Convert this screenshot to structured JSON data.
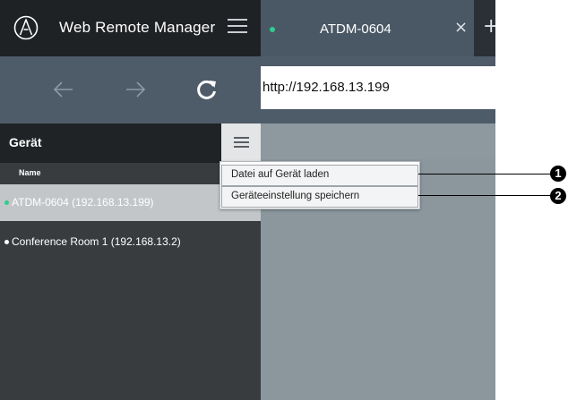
{
  "app": {
    "title": "Web Remote Manager"
  },
  "tab": {
    "label": "ATDM-0604",
    "close_symbol": "×",
    "new_tab_symbol": "+",
    "status_color": "#2ecc8f"
  },
  "navigation": {
    "back_icon": "arrow-left-icon",
    "forward_icon": "arrow-right-icon",
    "reload_icon": "reload-icon",
    "url": "http://192.168.13.199"
  },
  "sidebar": {
    "title": "Gerät",
    "menu_icon": "hamburger-icon",
    "column_header": "Name",
    "devices": [
      {
        "label": "ATDM-0604 (192.168.13.199)",
        "selected": true,
        "dot_color": "#2ecc8f"
      },
      {
        "label": "Conference Room 1 (192.168.13.2)",
        "selected": false,
        "dot_color": "#ffffff"
      }
    ]
  },
  "menu": {
    "items": [
      {
        "label": "Datei auf Gerät laden"
      },
      {
        "label": "Geräteeinstellung speichern"
      }
    ]
  },
  "callouts": [
    {
      "number": "1"
    },
    {
      "number": "2"
    }
  ],
  "colors": {
    "titlebar": "#1f2225",
    "navbar": "#4e5b68",
    "sidebar": "#393c3f",
    "content": "#8b969d",
    "accent": "#2ecc8f"
  }
}
